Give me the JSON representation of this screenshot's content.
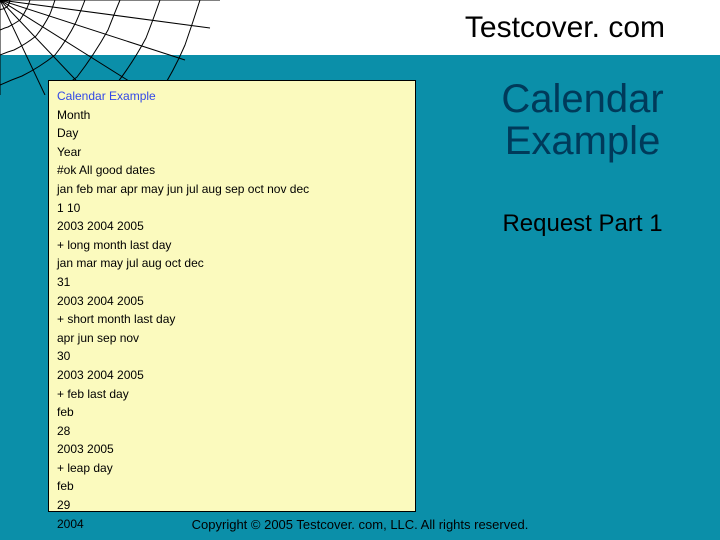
{
  "header": {
    "title": "Testcover. com"
  },
  "slide": {
    "heading_line1": "Calendar",
    "heading_line2": "Example",
    "subheading": "Request Part 1"
  },
  "code": {
    "title": "Calendar Example",
    "lines": [
      "Month",
      "Day",
      "Year",
      "#ok All good dates",
      "jan feb mar apr may jun jul aug sep oct nov dec",
      "1 10",
      "2003 2004 2005",
      "+ long month last day",
      "jan mar may jul aug oct dec",
      "31",
      "2003 2004 2005",
      "+ short month last day",
      "apr jun sep nov",
      "30",
      "2003 2004 2005",
      "+ feb last day",
      "feb",
      "28",
      "2003 2005",
      "+ leap day",
      "feb",
      "29",
      "2004"
    ]
  },
  "footer": {
    "copyright": "Copyright © 2005 Testcover. com, LLC. All rights reserved."
  }
}
